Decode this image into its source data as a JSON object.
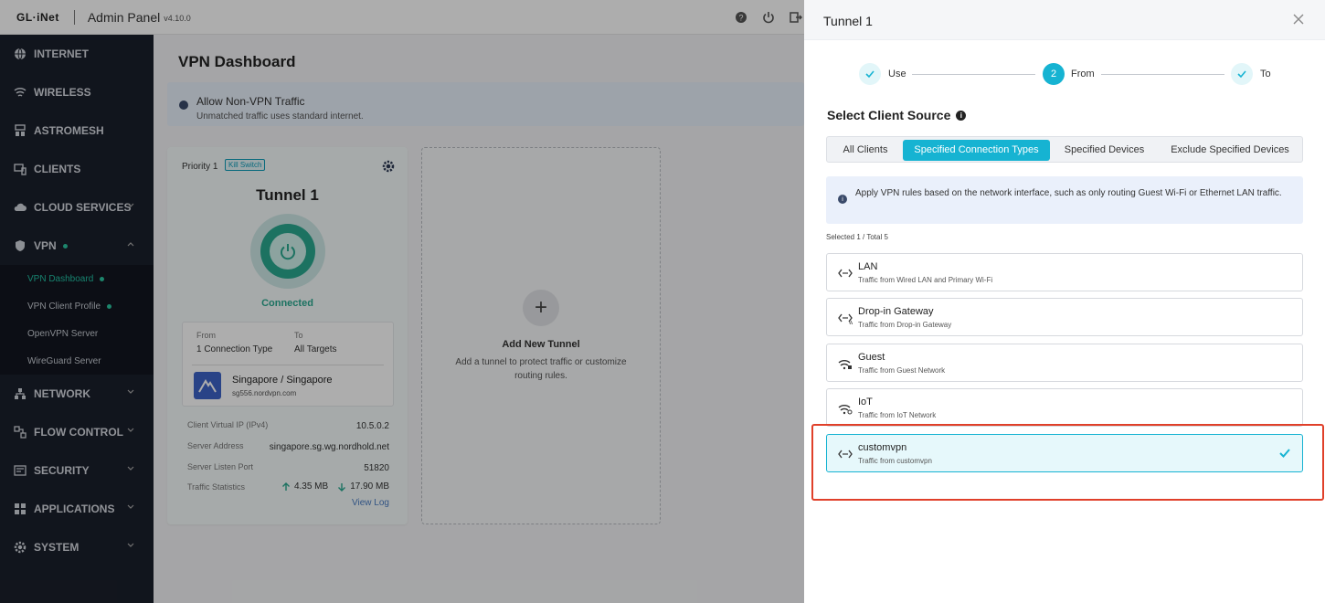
{
  "topbar": {
    "logo": "GL·iNet",
    "title": "Admin Panel",
    "version": "v4.10.0"
  },
  "sidebar": {
    "items": [
      {
        "label": "INTERNET",
        "icon": "globe-icon"
      },
      {
        "label": "WIRELESS",
        "icon": "wifi-icon"
      },
      {
        "label": "ASTROMESH",
        "icon": "mesh-icon"
      },
      {
        "label": "CLIENTS",
        "icon": "clients-icon"
      },
      {
        "label": "CLOUD SERVICES",
        "icon": "cloud-icon"
      },
      {
        "label": "VPN",
        "icon": "shield-icon"
      },
      {
        "label": "NETWORK",
        "icon": "network-icon"
      },
      {
        "label": "FLOW CONTROL",
        "icon": "flow-icon"
      },
      {
        "label": "SECURITY",
        "icon": "security-icon"
      },
      {
        "label": "APPLICATIONS",
        "icon": "apps-icon"
      },
      {
        "label": "SYSTEM",
        "icon": "gear-icon"
      }
    ],
    "vpn_sub": [
      {
        "label": "VPN Dashboard"
      },
      {
        "label": "VPN Client Profile"
      },
      {
        "label": "OpenVPN Server"
      },
      {
        "label": "WireGuard Server"
      }
    ]
  },
  "main": {
    "title": "VPN Dashboard",
    "banner": {
      "title": "Allow Non-VPN Traffic",
      "desc": "Unmatched traffic uses standard internet."
    },
    "tunnel": {
      "priority": "Priority 1",
      "kill_switch": "Kill Switch",
      "name": "Tunnel 1",
      "status": "Connected",
      "from_label": "From",
      "from_value": "1 Connection Type",
      "to_label": "To",
      "to_value": "All Targets",
      "server_name": "Singapore / Singapore",
      "server_host": "sg556.nordvpn.com",
      "ip_label": "Client Virtual IP (IPv4)",
      "ip_value": "10.5.0.2",
      "addr_label": "Server Address",
      "addr_value": "singapore.sg.wg.nordhold.net",
      "port_label": "Server Listen Port",
      "port_value": "51820",
      "traffic_label": "Traffic Statistics",
      "up": "4.35 MB",
      "down": "17.90 MB",
      "view_log": "View Log"
    },
    "add": {
      "title": "Add New Tunnel",
      "desc": "Add a tunnel to protect traffic or customize routing rules."
    }
  },
  "drawer": {
    "title": "Tunnel 1",
    "steps": [
      {
        "label": "Use",
        "state": "done"
      },
      {
        "label": "From",
        "num": "2",
        "state": "current"
      },
      {
        "label": "To",
        "state": "done"
      }
    ],
    "section_title": "Select Client Source",
    "tabs": [
      "All Clients",
      "Specified Connection Types",
      "Specified Devices",
      "Exclude Specified Devices"
    ],
    "active_tab": "Specified Connection Types",
    "note": "Apply VPN rules based on the network interface, such as only routing Guest Wi-Fi or Ethernet LAN traffic.",
    "selected_count": "Selected 1 / Total 5",
    "options": [
      {
        "name": "LAN",
        "desc": "Traffic from Wired LAN and Primary Wi-Fi",
        "icon": "ethernet-icon"
      },
      {
        "name": "Drop-in Gateway",
        "desc": "Traffic from Drop-in Gateway",
        "icon": "gateway-icon"
      },
      {
        "name": "Guest",
        "desc": "Traffic from Guest Network",
        "icon": "guest-wifi-icon"
      },
      {
        "name": "IoT",
        "desc": "Traffic from IoT Network",
        "icon": "iot-wifi-icon"
      },
      {
        "name": "customvpn",
        "desc": "Traffic from customvpn",
        "icon": "ethernet-icon",
        "selected": true
      }
    ]
  },
  "colors": {
    "accent": "#16b3d2",
    "green": "#2aa890",
    "sidebar": "#1a1f2b",
    "highlight": "#e0402a"
  }
}
